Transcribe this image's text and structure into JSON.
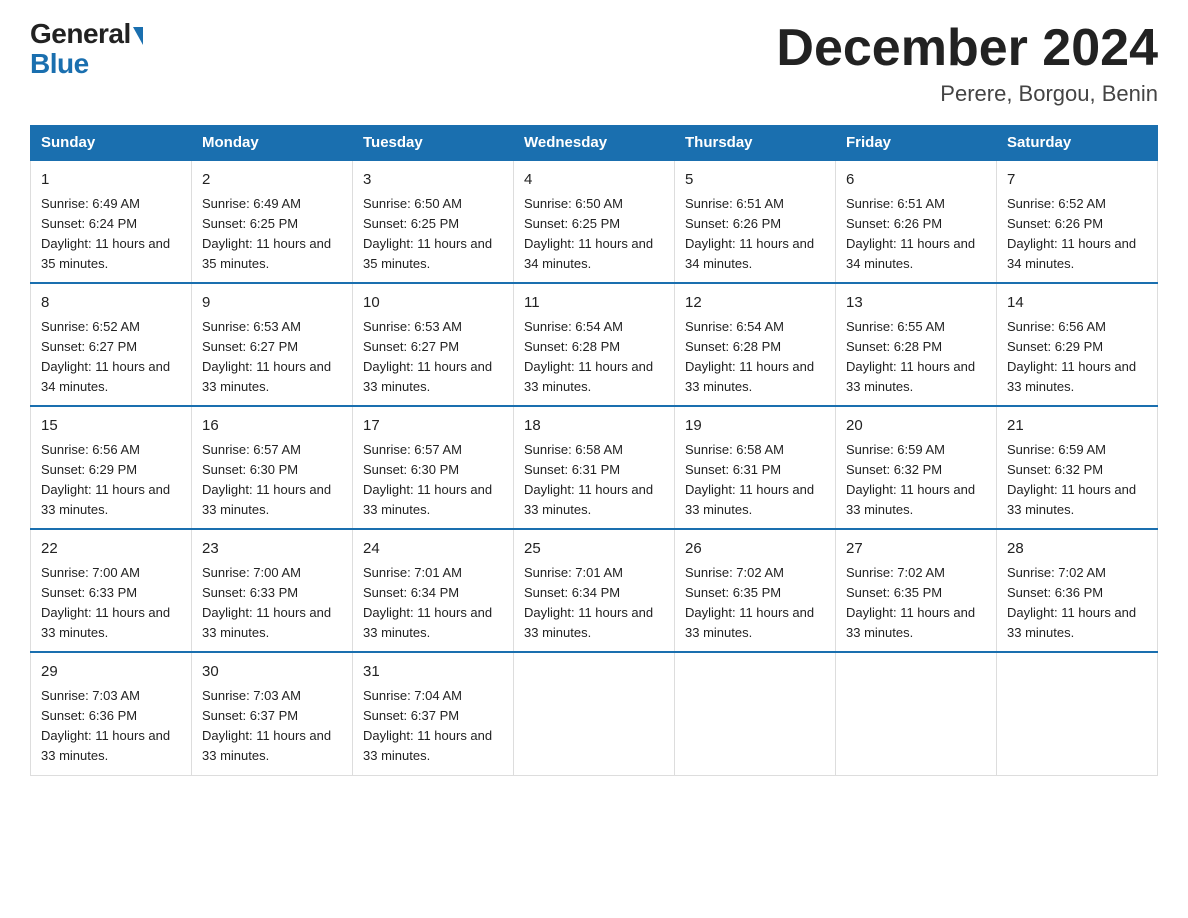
{
  "logo": {
    "general": "General",
    "blue": "Blue"
  },
  "title": "December 2024",
  "subtitle": "Perere, Borgou, Benin",
  "days_of_week": [
    "Sunday",
    "Monday",
    "Tuesday",
    "Wednesday",
    "Thursday",
    "Friday",
    "Saturday"
  ],
  "weeks": [
    [
      {
        "day": 1,
        "sunrise": "6:49 AM",
        "sunset": "6:24 PM",
        "daylight": "11 hours and 35 minutes."
      },
      {
        "day": 2,
        "sunrise": "6:49 AM",
        "sunset": "6:25 PM",
        "daylight": "11 hours and 35 minutes."
      },
      {
        "day": 3,
        "sunrise": "6:50 AM",
        "sunset": "6:25 PM",
        "daylight": "11 hours and 35 minutes."
      },
      {
        "day": 4,
        "sunrise": "6:50 AM",
        "sunset": "6:25 PM",
        "daylight": "11 hours and 34 minutes."
      },
      {
        "day": 5,
        "sunrise": "6:51 AM",
        "sunset": "6:26 PM",
        "daylight": "11 hours and 34 minutes."
      },
      {
        "day": 6,
        "sunrise": "6:51 AM",
        "sunset": "6:26 PM",
        "daylight": "11 hours and 34 minutes."
      },
      {
        "day": 7,
        "sunrise": "6:52 AM",
        "sunset": "6:26 PM",
        "daylight": "11 hours and 34 minutes."
      }
    ],
    [
      {
        "day": 8,
        "sunrise": "6:52 AM",
        "sunset": "6:27 PM",
        "daylight": "11 hours and 34 minutes."
      },
      {
        "day": 9,
        "sunrise": "6:53 AM",
        "sunset": "6:27 PM",
        "daylight": "11 hours and 33 minutes."
      },
      {
        "day": 10,
        "sunrise": "6:53 AM",
        "sunset": "6:27 PM",
        "daylight": "11 hours and 33 minutes."
      },
      {
        "day": 11,
        "sunrise": "6:54 AM",
        "sunset": "6:28 PM",
        "daylight": "11 hours and 33 minutes."
      },
      {
        "day": 12,
        "sunrise": "6:54 AM",
        "sunset": "6:28 PM",
        "daylight": "11 hours and 33 minutes."
      },
      {
        "day": 13,
        "sunrise": "6:55 AM",
        "sunset": "6:28 PM",
        "daylight": "11 hours and 33 minutes."
      },
      {
        "day": 14,
        "sunrise": "6:56 AM",
        "sunset": "6:29 PM",
        "daylight": "11 hours and 33 minutes."
      }
    ],
    [
      {
        "day": 15,
        "sunrise": "6:56 AM",
        "sunset": "6:29 PM",
        "daylight": "11 hours and 33 minutes."
      },
      {
        "day": 16,
        "sunrise": "6:57 AM",
        "sunset": "6:30 PM",
        "daylight": "11 hours and 33 minutes."
      },
      {
        "day": 17,
        "sunrise": "6:57 AM",
        "sunset": "6:30 PM",
        "daylight": "11 hours and 33 minutes."
      },
      {
        "day": 18,
        "sunrise": "6:58 AM",
        "sunset": "6:31 PM",
        "daylight": "11 hours and 33 minutes."
      },
      {
        "day": 19,
        "sunrise": "6:58 AM",
        "sunset": "6:31 PM",
        "daylight": "11 hours and 33 minutes."
      },
      {
        "day": 20,
        "sunrise": "6:59 AM",
        "sunset": "6:32 PM",
        "daylight": "11 hours and 33 minutes."
      },
      {
        "day": 21,
        "sunrise": "6:59 AM",
        "sunset": "6:32 PM",
        "daylight": "11 hours and 33 minutes."
      }
    ],
    [
      {
        "day": 22,
        "sunrise": "7:00 AM",
        "sunset": "6:33 PM",
        "daylight": "11 hours and 33 minutes."
      },
      {
        "day": 23,
        "sunrise": "7:00 AM",
        "sunset": "6:33 PM",
        "daylight": "11 hours and 33 minutes."
      },
      {
        "day": 24,
        "sunrise": "7:01 AM",
        "sunset": "6:34 PM",
        "daylight": "11 hours and 33 minutes."
      },
      {
        "day": 25,
        "sunrise": "7:01 AM",
        "sunset": "6:34 PM",
        "daylight": "11 hours and 33 minutes."
      },
      {
        "day": 26,
        "sunrise": "7:02 AM",
        "sunset": "6:35 PM",
        "daylight": "11 hours and 33 minutes."
      },
      {
        "day": 27,
        "sunrise": "7:02 AM",
        "sunset": "6:35 PM",
        "daylight": "11 hours and 33 minutes."
      },
      {
        "day": 28,
        "sunrise": "7:02 AM",
        "sunset": "6:36 PM",
        "daylight": "11 hours and 33 minutes."
      }
    ],
    [
      {
        "day": 29,
        "sunrise": "7:03 AM",
        "sunset": "6:36 PM",
        "daylight": "11 hours and 33 minutes."
      },
      {
        "day": 30,
        "sunrise": "7:03 AM",
        "sunset": "6:37 PM",
        "daylight": "11 hours and 33 minutes."
      },
      {
        "day": 31,
        "sunrise": "7:04 AM",
        "sunset": "6:37 PM",
        "daylight": "11 hours and 33 minutes."
      },
      null,
      null,
      null,
      null
    ]
  ]
}
